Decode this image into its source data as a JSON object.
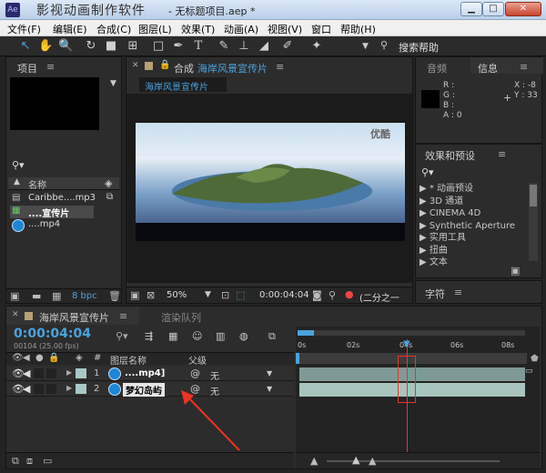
{
  "window": {
    "watermark": "影视动画制作软件",
    "title": "- 无标题项目.aep *",
    "min": "▁",
    "max": "□",
    "close": "✕"
  },
  "menu": [
    "文件(F)",
    "编辑(E)",
    "合成(C)",
    "图层(L)",
    "效果(T)",
    "动画(A)",
    "视图(V)",
    "窗口",
    "帮助(H)"
  ],
  "toolbar": {
    "search": "搜索帮助"
  },
  "project": {
    "tab": "项目",
    "col_name": "名称",
    "items": [
      {
        "name": "Caribbe....mp3"
      },
      {
        "name": "....宣传片"
      },
      {
        "name": "....mp4"
      }
    ],
    "bpc": "8 bpc"
  },
  "comp": {
    "tab_prefix": "合成",
    "tab_name": "海岸风景宣传片",
    "subtab": "海岸风景宣传片",
    "watermark": "优酷",
    "zoom": "50%",
    "timecode": "0:00:04:04",
    "res": "(二分之一"
  },
  "right": {
    "tab_audio": "音频",
    "tab_info": "信息",
    "r": "R :",
    "g": "G :",
    "b": "B :",
    "a": "A : 0",
    "x": "X : -8",
    "y": "Y : 33",
    "effects_tab": "效果和预设",
    "effects": [
      "* 动画预设",
      "3D 通道",
      "CINEMA 4D",
      "Synthetic Aperture",
      "实用工具",
      "扭曲",
      "文本"
    ],
    "char_tab": "字符"
  },
  "timeline": {
    "tab": "海岸风景宣传片",
    "render_tab": "渲染队列",
    "timecode": "0:00:04:04",
    "frames": "00104 (25.00 fps)",
    "col_num": "#",
    "col_name": "图层名称",
    "col_parent": "父级",
    "layers": [
      {
        "num": "1",
        "name": "....mp4]",
        "parent": "无"
      },
      {
        "num": "2",
        "name": "梦幻岛屿",
        "parent": "无"
      }
    ],
    "ruler": [
      "0s",
      "02s",
      "04s",
      "06s",
      "08s"
    ]
  }
}
